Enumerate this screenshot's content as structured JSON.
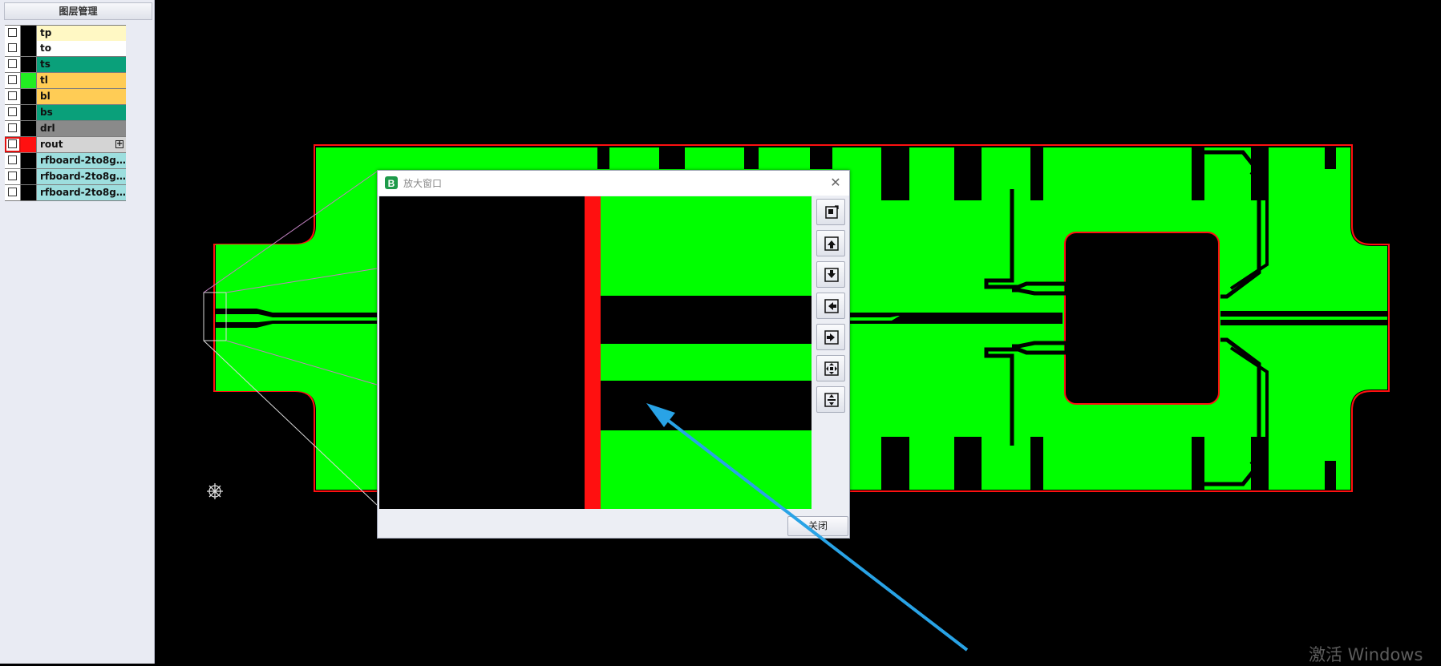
{
  "layer_panel": {
    "title": "图层管理",
    "layers": [
      {
        "name": "tp",
        "color": "#fff8c4",
        "swatch": "#000000"
      },
      {
        "name": "to",
        "color": "#ffffff",
        "swatch": "#000000"
      },
      {
        "name": "ts",
        "color": "#0aa07a",
        "swatch": "#000000"
      },
      {
        "name": "tl",
        "color": "#ffcc55",
        "swatch": "#22ee22"
      },
      {
        "name": "bl",
        "color": "#ffcc55",
        "swatch": "#000000"
      },
      {
        "name": "bs",
        "color": "#0aa07a",
        "swatch": "#000000"
      },
      {
        "name": "drl",
        "color": "#8a8a8a",
        "swatch": "#000000"
      },
      {
        "name": "rout",
        "color": "#d4d4d4",
        "swatch": "#ff1010",
        "active": true
      },
      {
        "name": "rfboard-2to8gh...",
        "color": "#9ddede",
        "swatch": "#000000"
      },
      {
        "name": "rfboard-2to8gh...",
        "color": "#9ddede",
        "swatch": "#000000"
      },
      {
        "name": "rfboard-2to8gh...",
        "color": "#9ddede",
        "swatch": "#000000"
      }
    ]
  },
  "colors": {
    "copper": "#00ff00",
    "outline": "#ff1010",
    "background": "#000000",
    "arrow": "#29a3e6"
  },
  "magnifier": {
    "title": "放大窗口",
    "close_icon": "close-icon",
    "close_button": "关闭",
    "tools": [
      {
        "name": "zoom-fit-icon"
      },
      {
        "name": "move-up-icon"
      },
      {
        "name": "move-down-icon"
      },
      {
        "name": "move-left-icon"
      },
      {
        "name": "move-right-icon"
      },
      {
        "name": "expand-all-icon"
      },
      {
        "name": "expand-vertical-icon"
      }
    ]
  },
  "watermark": "激活 Windows"
}
